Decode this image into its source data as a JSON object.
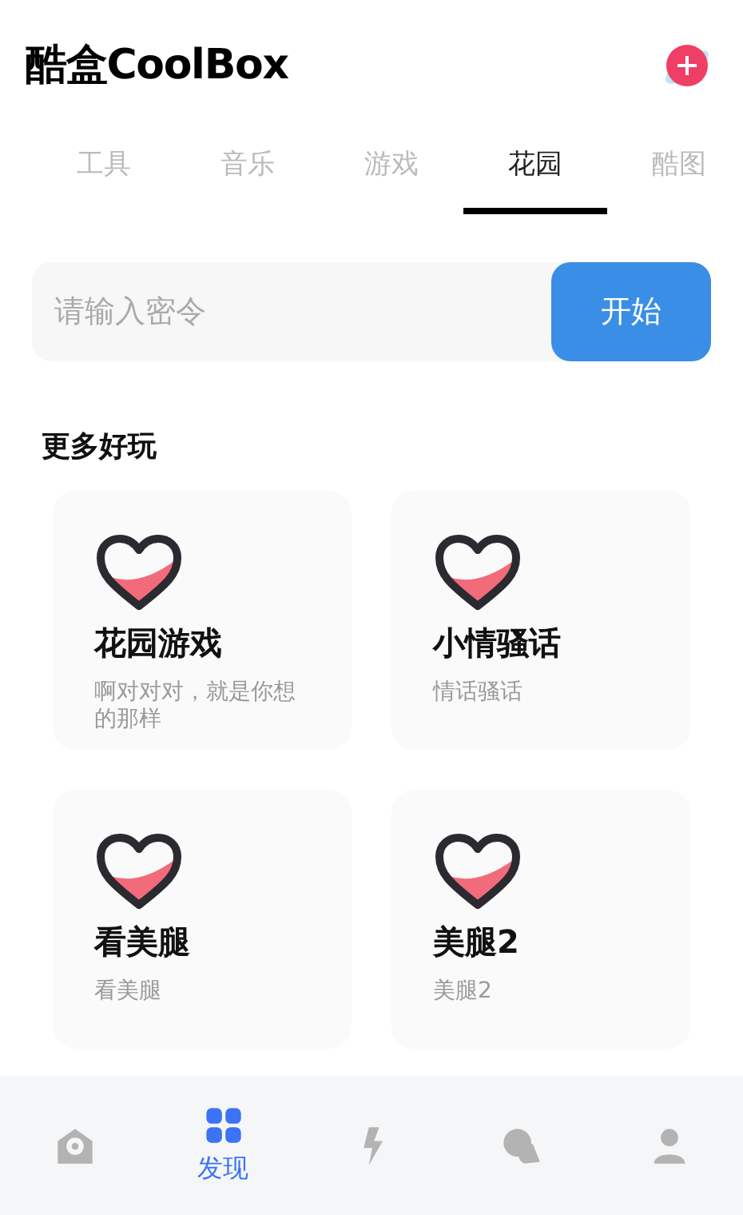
{
  "header": {
    "logo": "酷盒CoolBox"
  },
  "tabs": [
    {
      "label": "工具",
      "selected": false
    },
    {
      "label": "音乐",
      "selected": false
    },
    {
      "label": "游戏",
      "selected": false
    },
    {
      "label": "花园",
      "selected": true
    },
    {
      "label": "酷图",
      "selected": false
    }
  ],
  "search": {
    "placeholder": "请输入密令",
    "button": "开始"
  },
  "section_title": "更多好玩",
  "cards": [
    {
      "title": "花园游戏",
      "subtitle": "啊对对对，就是你想的那样"
    },
    {
      "title": "小情骚话",
      "subtitle": "情话骚话"
    },
    {
      "title": "看美腿",
      "subtitle": "看美腿"
    },
    {
      "title": "美腿2",
      "subtitle": "美腿2"
    }
  ],
  "bottom_nav": [
    {
      "kind": "home",
      "selected": false
    },
    {
      "kind": "discover",
      "selected": true,
      "label": "发现"
    },
    {
      "kind": "flash",
      "selected": false
    },
    {
      "kind": "chat",
      "selected": false
    },
    {
      "kind": "user",
      "selected": false
    }
  ]
}
